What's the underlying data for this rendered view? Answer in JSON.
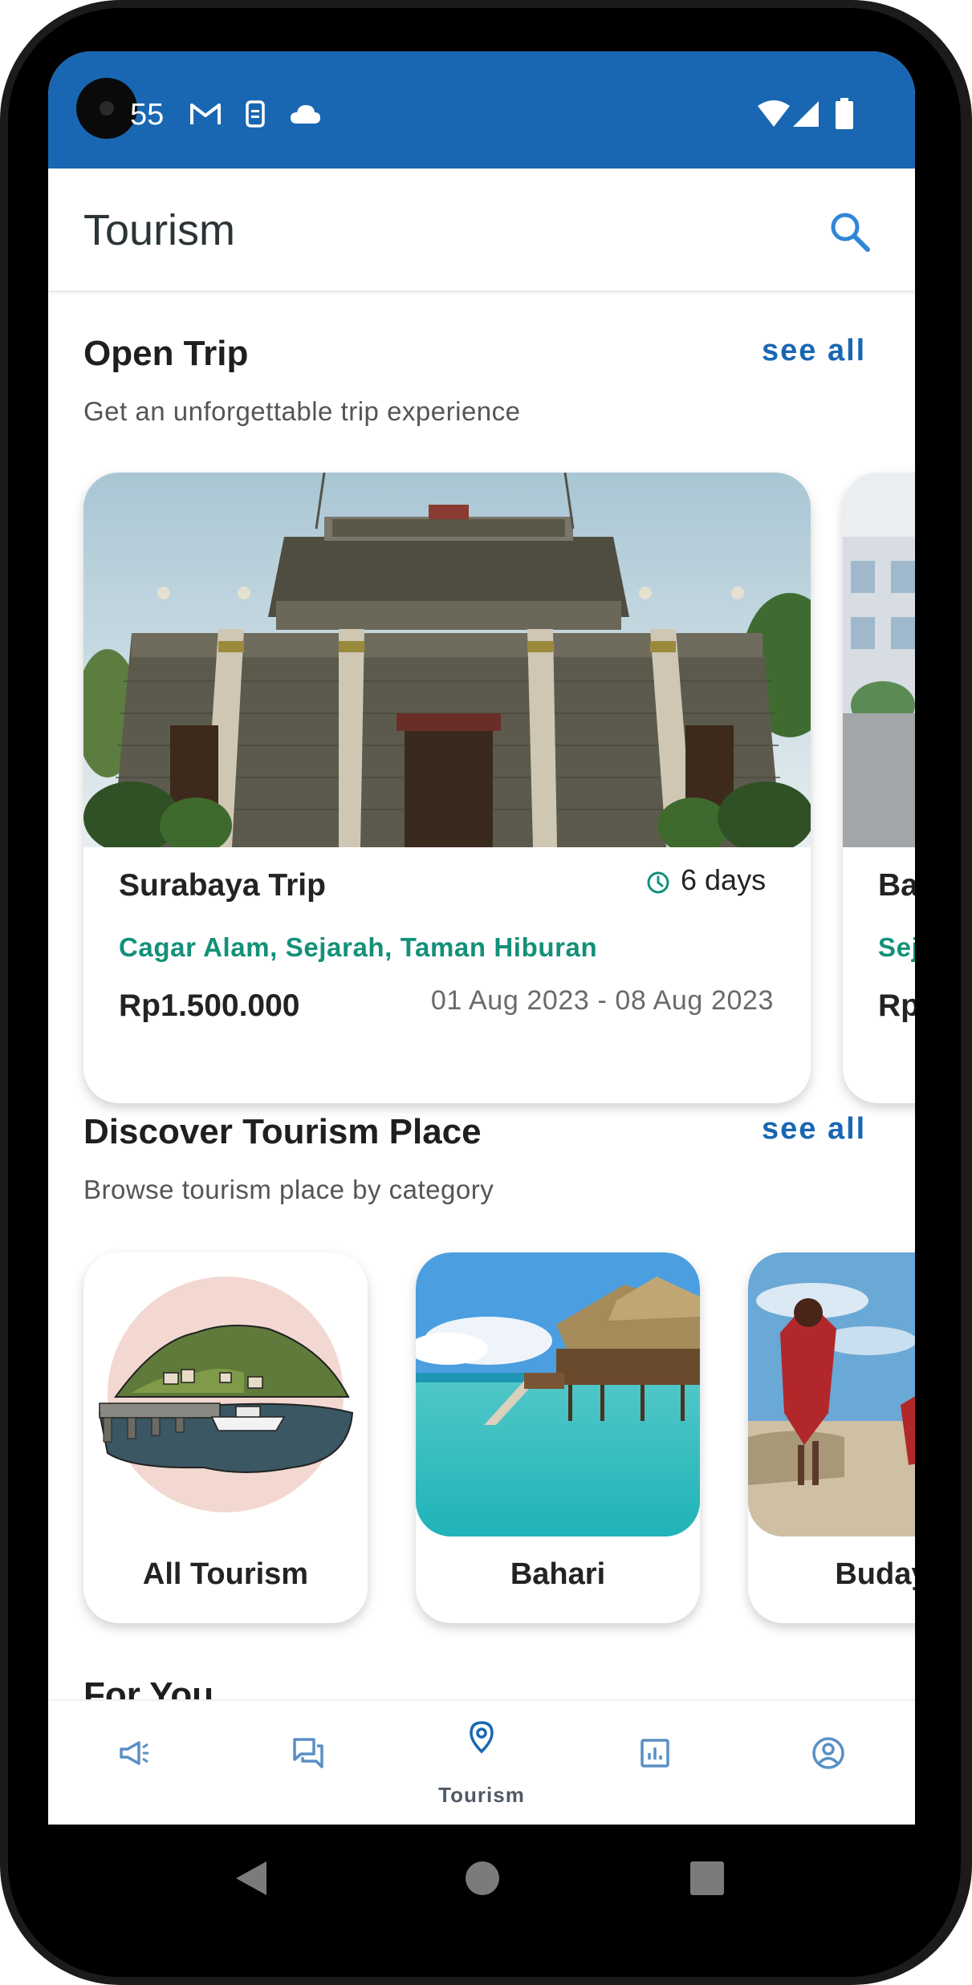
{
  "status_bar": {
    "time": "55",
    "icons": [
      "gmail-icon",
      "sim-alert-icon",
      "cloud-icon",
      "wifi-icon",
      "signal-icon",
      "battery-icon"
    ]
  },
  "app_bar": {
    "title": "Tourism",
    "search_icon": "search-icon"
  },
  "open_trip": {
    "title": "Open Trip",
    "subtitle": "Get an unforgettable trip experience",
    "see_all": "see all",
    "cards": [
      {
        "name": "Surabaya Trip",
        "duration": "6 days",
        "tags": "Cagar Alam, Sejarah, Taman Hiburan",
        "price": "Rp1.500.000",
        "dates": "01 Aug 2023 - 08 Aug 2023",
        "image": "samporna-building-photo"
      },
      {
        "name": "Ba",
        "tags": "Sej",
        "price": "Rp",
        "image": "street-building-photo"
      }
    ]
  },
  "discover": {
    "title": "Discover Tourism Place",
    "subtitle": "Browse tourism place by category",
    "see_all": "see all",
    "categories": [
      {
        "label": "All Tourism",
        "image": "harbor-illustration"
      },
      {
        "label": "Bahari",
        "image": "water-villa-photo"
      },
      {
        "label": "Budaya",
        "image": "cultural-dancer-photo"
      }
    ]
  },
  "for_you": {
    "title": "For You"
  },
  "bottom_nav": {
    "items": [
      {
        "icon": "megaphone-icon",
        "label": ""
      },
      {
        "icon": "chat-icon",
        "label": ""
      },
      {
        "icon": "location-pin-icon",
        "label": "Tourism",
        "active": true
      },
      {
        "icon": "chart-icon",
        "label": ""
      },
      {
        "icon": "profile-icon",
        "label": ""
      }
    ]
  },
  "colors": {
    "status_bar": "#1967b2",
    "accent": "#1967b2",
    "tag_green": "#139079",
    "nav_icon": "#5a8fc4"
  }
}
